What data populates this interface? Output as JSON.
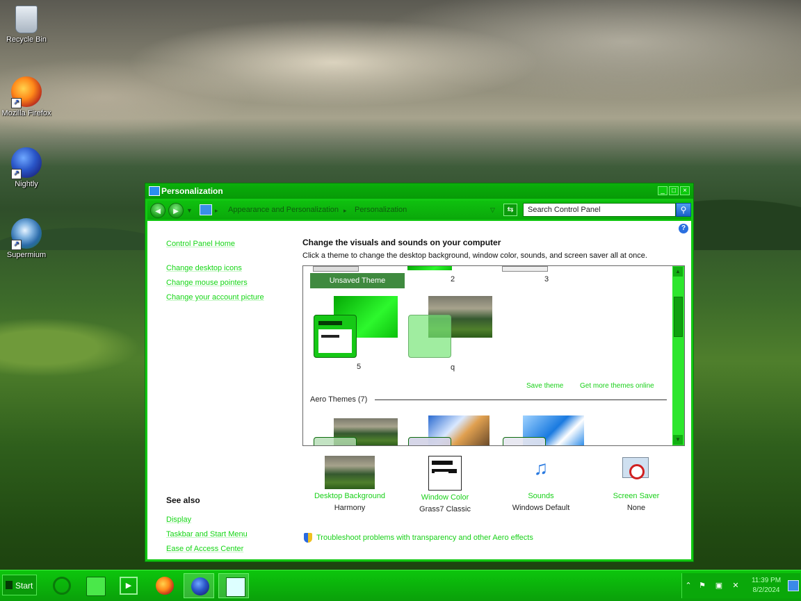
{
  "desktop": {
    "icons": [
      {
        "label": "Recycle Bin",
        "icon": "recycle-bin-icon"
      },
      {
        "label": "Mozilla Firefox",
        "icon": "firefox-icon"
      },
      {
        "label": "Nightly",
        "icon": "nightly-icon"
      },
      {
        "label": "Supermium",
        "icon": "supermium-icon"
      }
    ]
  },
  "window": {
    "title": "Personalization",
    "breadcrumb": [
      "Appearance and Personalization",
      "Personalization"
    ],
    "search_placeholder": "Search Control Panel",
    "left_links": [
      "Control Panel Home",
      "Change desktop icons",
      "Change mouse pointers",
      "Change your account picture"
    ],
    "see_also_title": "See also",
    "see_also_links": [
      "Display",
      "Taskbar and Start Menu",
      "Ease of Access Center"
    ],
    "heading": "Change the visuals and sounds on your computer",
    "subheading": "Click a theme to change the desktop background, window color, sounds, and screen saver all at once.",
    "themes": {
      "my_themes": [
        "Unsaved Theme",
        "2",
        "3",
        "5",
        "q"
      ],
      "save_theme": "Save theme",
      "get_more": "Get more themes online",
      "aero_title": "Aero Themes (7)"
    },
    "bottom": [
      {
        "label": "Desktop Background",
        "value": "Harmony"
      },
      {
        "label": "Window Color",
        "value": "Grass7 Classic"
      },
      {
        "label": "Sounds",
        "value": "Windows Default"
      },
      {
        "label": "Screen Saver",
        "value": "None"
      }
    ],
    "troubleshoot": "Troubleshoot problems with transparency and other Aero effects"
  },
  "taskbar": {
    "start_label": "Start",
    "clock_time": "11:39 PM",
    "clock_date": "8/2/2024"
  },
  "colors": {
    "accent": "#12c812",
    "link": "#15d615"
  }
}
